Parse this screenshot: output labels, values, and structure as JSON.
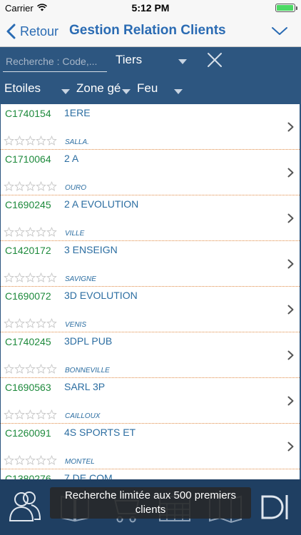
{
  "status_bar": {
    "carrier": "Carrier",
    "time": "5:12 PM",
    "battery_level": 0.95
  },
  "nav": {
    "back_label": "Retour",
    "title": "Gestion Relation Clients",
    "accent_color": "#2a6bb3"
  },
  "filters": {
    "search_placeholder": "Recherche : Code,...",
    "tiers_label": "Tiers",
    "columns": {
      "etoiles": "Etoiles",
      "zone": "Zone gé",
      "feu": "Feu"
    },
    "bg_color": "#2d5680"
  },
  "clients": [
    {
      "code": "C1740154",
      "name": "1ERE",
      "city": "SALLA.",
      "stars": 0
    },
    {
      "code": "C1710064",
      "name": "2 A",
      "city": "OURO",
      "stars": 0
    },
    {
      "code": "C1690245",
      "name": "2 A EVOLUTION",
      "city": "VILLE",
      "stars": 0
    },
    {
      "code": "C1420172",
      "name": "3 ENSEIGN",
      "city": "SAVIGNE",
      "stars": 0
    },
    {
      "code": "C1690072",
      "name": "3D EVOLUTION",
      "city": "VENIS",
      "stars": 0
    },
    {
      "code": "C1740245",
      "name": "3DPL PUB",
      "city": "BONNEVILLE",
      "stars": 0
    },
    {
      "code": "C1690563",
      "name": "SARL 3P",
      "city": "CAILLOUX",
      "stars": 0
    },
    {
      "code": "C1260091",
      "name": "4S SPORTS ET",
      "city": "MONTEL",
      "stars": 0
    },
    {
      "code": "C1380276",
      "name": "7 DE COM",
      "city": "",
      "stars": 0
    }
  ],
  "tab_bar": {
    "items": [
      {
        "icon": "users-icon"
      },
      {
        "icon": "book-icon"
      },
      {
        "icon": "cart-icon"
      },
      {
        "icon": "calendar-icon"
      },
      {
        "icon": "map-icon"
      },
      {
        "icon": "document-icon"
      }
    ]
  },
  "toast": {
    "message": "Recherche limitée aux 500 premiers clients"
  }
}
